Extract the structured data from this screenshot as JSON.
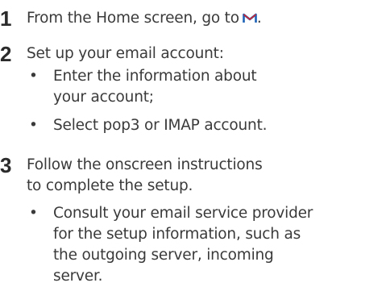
{
  "steps": [
    {
      "number": "1",
      "text": "From the Home screen, go to",
      "icon": "mail-icon",
      "after_icon": "."
    },
    {
      "number": "2",
      "text": "Set up your email account:",
      "bullets": [
        "Enter the information about your account;",
        "Select pop3 or IMAP account."
      ]
    },
    {
      "number": "3",
      "text": "Follow the onscreen instructions to complete the setup.",
      "bullets": [
        "Consult your email service provider for the setup information, such as the outgoing server, incoming server."
      ]
    }
  ],
  "bullet_symbol": "•",
  "colors": {
    "text": "#3a3a3a",
    "icon_blue": "#1e63b8",
    "icon_red": "#d4232c"
  }
}
